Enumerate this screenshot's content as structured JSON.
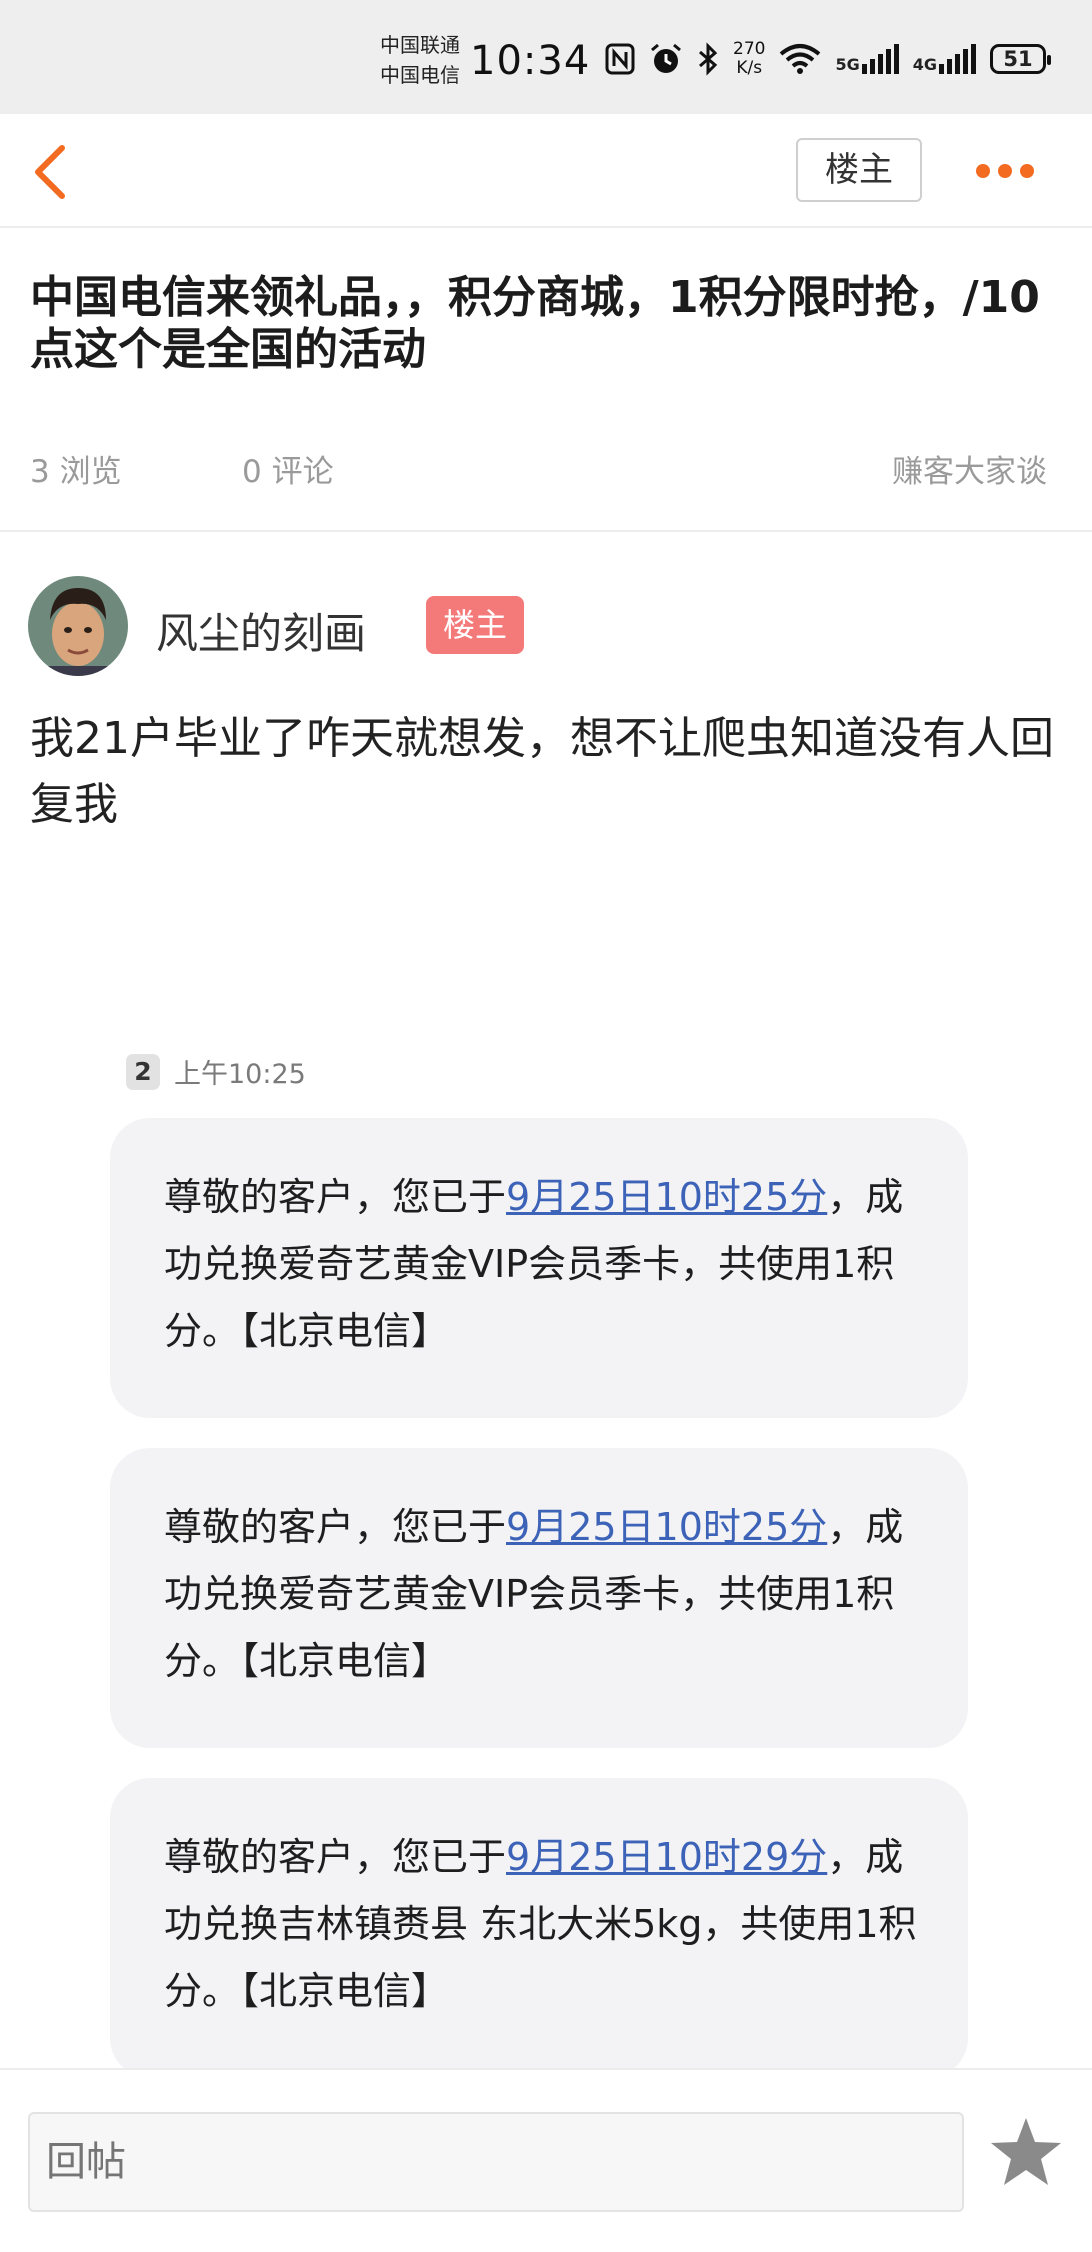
{
  "status_bar": {
    "carrier_1": "中国联通",
    "carrier_2": "中国电信",
    "time": "10:34",
    "speed_value": "270",
    "speed_unit": "K/s",
    "net_1": "5G",
    "net_2": "4G",
    "battery": "51"
  },
  "nav": {
    "owner_button": "楼主"
  },
  "post": {
    "title": "中国电信来领礼品，，积分商城，1积分限时抢，/10点这个是全国的活动",
    "views": "3 浏览",
    "comments": "0 评论",
    "board": "赚客大家谈",
    "author": "风尘的刻画",
    "author_badge": "楼主",
    "body": "我21户毕业了咋天就想发，想不让爬虫知道没有人回复我"
  },
  "sms_screenshot": {
    "sim": "2",
    "time": "上午10:25",
    "messages": [
      {
        "pre": "尊敬的客户，您已于",
        "highlight": "9月25日10时25分",
        "post": "，成功兑换爱奇艺黄金VIP会员季卡，共使用1积分。【北京电信】"
      },
      {
        "pre": "尊敬的客户，您已于",
        "highlight": "9月25日10时25分",
        "post": "，成功兑换爱奇艺黄金VIP会员季卡，共使用1积分。【北京电信】"
      },
      {
        "pre": "尊敬的客户，您已于",
        "highlight": "9月25日10时29分",
        "post": "，成功兑换吉林镇赉县 东北大米5kg，共使用1积分。【北京电信】"
      }
    ]
  },
  "bottom": {
    "reply_placeholder": "回帖"
  },
  "colors": {
    "accent": "#f26b21",
    "owner_badge": "#f47a7a",
    "link": "#3d63b8"
  }
}
